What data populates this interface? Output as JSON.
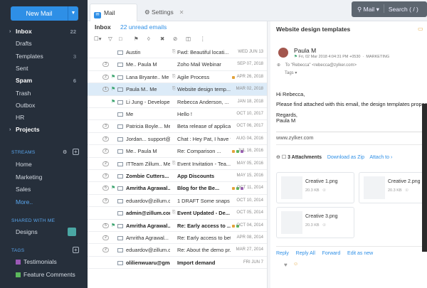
{
  "sidebar": {
    "new_mail": "New Mail",
    "folders": [
      {
        "label": "Inbox",
        "count": "22",
        "bold": true,
        "arrow": true
      },
      {
        "label": "Drafts",
        "count": "",
        "bold": false
      },
      {
        "label": "Templates",
        "count": "3",
        "bold": false
      },
      {
        "label": "Sent",
        "count": "",
        "bold": false
      },
      {
        "label": "Spam",
        "count": "6",
        "bold": true
      },
      {
        "label": "Trash",
        "count": "",
        "bold": false
      },
      {
        "label": "Outbox",
        "count": "",
        "bold": false
      },
      {
        "label": "HR",
        "count": "",
        "bold": false
      },
      {
        "label": "Projects",
        "count": "",
        "bold": true,
        "arrow": true
      }
    ],
    "streams_header": "STREAMS",
    "streams": [
      "Home",
      "Marketing",
      "Sales",
      "More.."
    ],
    "shared_header": "SHARED WITH ME",
    "shared": [
      "Designs"
    ],
    "tags_header": "TAGS",
    "tags": [
      {
        "label": "Testimonials",
        "color": "#9b59b6"
      },
      {
        "label": "Feature Comments",
        "color": "#5cb85c"
      }
    ]
  },
  "tabs": {
    "mail": "Mail",
    "settings": "Settings"
  },
  "search": {
    "scope": "Mail",
    "placeholder": "Search ( / )"
  },
  "list": {
    "title": "Inbox",
    "unread": "22 unread emails",
    "rows": [
      {
        "thread": "",
        "flag": false,
        "sender": "Austin",
        "clip": true,
        "subject": "Fwd: Beautiful locati...",
        "date": "WED JUN 13",
        "bold": false,
        "dots": []
      },
      {
        "thread": "3",
        "flag": false,
        "sender": "Me.. Paula M",
        "clip": false,
        "subject": "Zoho Mail Webinar",
        "date": "SEP 07, 2018",
        "bold": false,
        "dots": []
      },
      {
        "thread": "2",
        "flag": true,
        "sender": "Lana Bryante.. Me",
        "clip": true,
        "subject": "Agile Process",
        "date": "APR 26, 2018",
        "bold": false,
        "dots": [
          "#e3a33b"
        ]
      },
      {
        "thread": "1",
        "flag": true,
        "sender": "Paula M.. Me",
        "clip": true,
        "subject": "Website design temp...",
        "date": "MAR 02, 2018",
        "bold": false,
        "dots": [],
        "sel": true
      },
      {
        "thread": "",
        "flag": true,
        "sender": "Li Jung - Developer",
        "clip": false,
        "subject": "Rebecca Anderson, ...",
        "date": "JAN 18, 2018",
        "bold": false,
        "dots": []
      },
      {
        "thread": "",
        "flag": false,
        "sender": "Me",
        "clip": false,
        "subject": "Hello !",
        "date": "OCT 10, 2017",
        "bold": false,
        "dots": []
      },
      {
        "thread": "3",
        "flag": false,
        "sender": "Patricia Boyle... Me",
        "clip": false,
        "subject": "Beta release of applica...",
        "date": "OCT 06, 2017",
        "bold": false,
        "dots": []
      },
      {
        "thread": "3",
        "flag": false,
        "sender": "Jordan... support@z...",
        "clip": false,
        "subject": "Chat : Hey Pat, I have f...",
        "date": "AUG 04, 2016",
        "bold": false,
        "dots": []
      },
      {
        "thread": "2",
        "flag": false,
        "sender": "Me.. Paula M",
        "clip": false,
        "subject": "Re: Comparison ...",
        "date": "JUL 16, 2016",
        "bold": false,
        "dots": [
          "#e3a33b",
          "#5cb85c",
          "#9b59b6"
        ]
      },
      {
        "thread": "2",
        "flag": false,
        "sender": "ITTeam Zillum.. Me",
        "clip": true,
        "subject": "Event Invitation - Tea...",
        "date": "MAY 05, 2016",
        "bold": false,
        "dots": []
      },
      {
        "thread": "3",
        "flag": false,
        "sender": "Zombie Cutters... le...",
        "clip": false,
        "subject": "App Discounts",
        "date": "MAY 15, 2016",
        "bold": true,
        "dots": []
      },
      {
        "thread": "6",
        "flag": true,
        "sender": "Amritha Agrawal...",
        "clip": false,
        "subject": "Blog for the Be...",
        "date": "OCT 11, 2014",
        "bold": true,
        "dots": [
          "#e3a33b",
          "#5cb85c",
          "#9b59b6"
        ]
      },
      {
        "thread": "3",
        "flag": false,
        "sender": "eduardov@zillum.c...",
        "clip": false,
        "subject": "1 DRAFT  Some snaps f...",
        "date": "OCT 10, 2014",
        "bold": false,
        "dots": []
      },
      {
        "thread": "",
        "flag": false,
        "sender": "admin@zillum.com",
        "clip": true,
        "subject": "Event Updated - De...",
        "date": "OCT 05, 2014",
        "bold": true,
        "dots": []
      },
      {
        "thread": "5",
        "flag": true,
        "sender": "Amritha Agrawal...",
        "clip": false,
        "subject": "Re: Early access to ...",
        "date": "OCT 04, 2014",
        "bold": true,
        "dots": [
          "#e3a33b",
          "#5cb85c"
        ]
      },
      {
        "thread": "2",
        "flag": false,
        "sender": "Amritha Agrawal...",
        "clip": false,
        "subject": "Re: Early access to bet...",
        "date": "APR 08, 2014",
        "bold": false,
        "dots": []
      },
      {
        "thread": "2",
        "flag": false,
        "sender": "eduardov@zillum.c...",
        "clip": false,
        "subject": "Re: About the demo pr...",
        "date": "MAR 27, 2014",
        "bold": false,
        "dots": []
      },
      {
        "thread": "",
        "flag": false,
        "sender": "olilienwuaru@gmai...",
        "clip": false,
        "subject": "Import demand",
        "date": "FRI JUN 7",
        "bold": true,
        "dots": []
      }
    ]
  },
  "detail": {
    "subject": "Website design templates",
    "from": "Paula M",
    "meta": "Fri, 02 Mar 2018 4:04:31 PM +0530",
    "label": "MARKETING",
    "to_prefix": "To",
    "to": "\"Rebecca\" <rebecca@zylker.com>",
    "tags": "Tags",
    "greeting": "Hi Rebecca,",
    "body": "Please find attached with this email, the design templates proposed",
    "regards": "Regards,",
    "sig": "Paula M",
    "link": "www.zylker.com",
    "att_count": "3 Attachments",
    "dl_zip": "Download as Zip",
    "attach_to": "Attach to ›",
    "attachments": [
      {
        "name": "Creative 1.png",
        "size": "20.3 KB"
      },
      {
        "name": "Creative 2.png",
        "size": "20.3 KB"
      },
      {
        "name": "Creative 3.png",
        "size": "20.3 KB"
      }
    ],
    "actions": [
      "Reply",
      "Reply All",
      "Forward",
      "Edit as new"
    ]
  },
  "colors": {
    "accent": "#2e8fe6",
    "sidebar": "#262f3b",
    "selected": "#dcebf8"
  }
}
